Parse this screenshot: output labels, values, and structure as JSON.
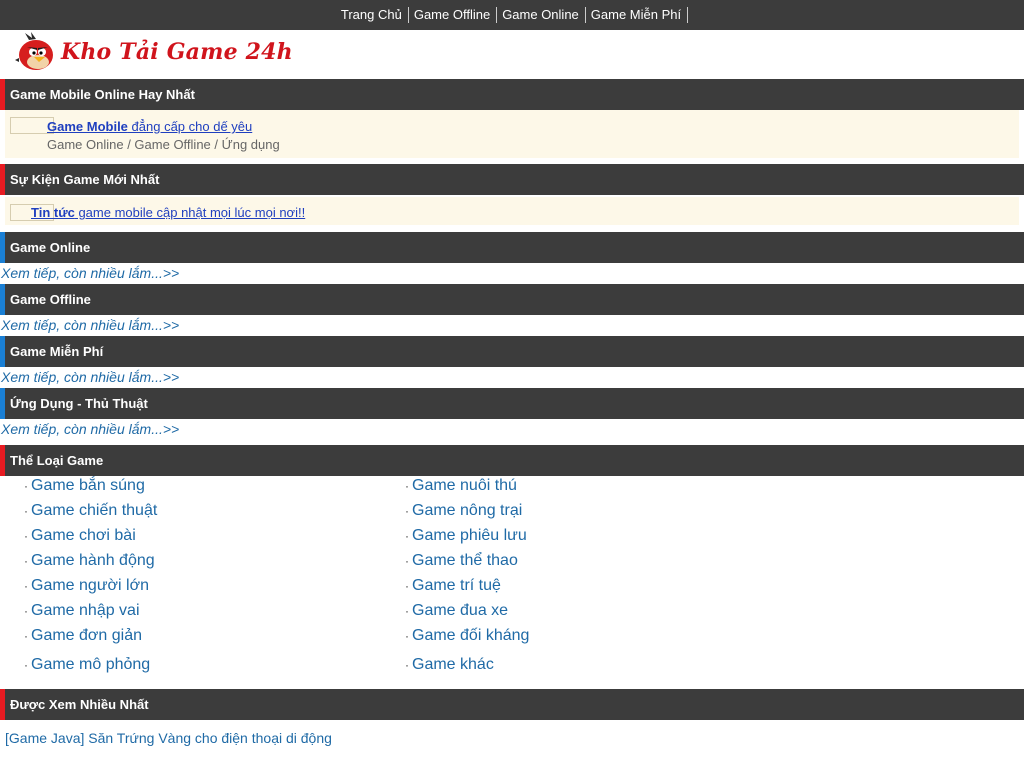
{
  "nav": {
    "items": [
      "Trang Chủ",
      "Game Offline",
      "Game Online",
      "Game Miễn Phí"
    ]
  },
  "logo": {
    "text": "Kho Tải Game 24h",
    "icon": "angry-bird-logo-icon"
  },
  "sections": {
    "mobile_online": {
      "title": "Game Mobile Online Hay Nhất",
      "featured_bold": "Game Mobile",
      "featured_text": " đẳng cấp cho dế yêu",
      "featured_breadcrumb": "Game Online / Game Offline / Ứng dụng"
    },
    "events": {
      "title": "Sự Kiện Game Mới Nhất",
      "featured_bold": "Tin tức",
      "featured_text": " game mobile cập nhật mọi lúc mọi nơi!!"
    },
    "game_online": {
      "title": "Game Online",
      "more": "Xem tiếp, còn nhiều lắm...>>"
    },
    "game_offline": {
      "title": "Game Offline",
      "more": "Xem tiếp, còn nhiều lắm...>>"
    },
    "game_free": {
      "title": "Game Miễn Phí",
      "more": "Xem tiếp, còn nhiều lắm...>>"
    },
    "apps": {
      "title": "Ứng Dụng - Thủ Thuật",
      "more": "Xem tiếp, còn nhiều lắm...>>"
    },
    "categories": {
      "title": "Thể Loại Game",
      "bullet": "·",
      "left": [
        "Game bắn súng",
        "Game chiến thuật",
        "Game chơi bài",
        "Game hành động",
        "Game người lớn",
        "Game nhập vai",
        "Game đơn giản",
        "Game mô phỏng"
      ],
      "right": [
        "Game nuôi thú",
        "Game nông trại",
        "Game phiêu lưu",
        "Game thể thao",
        "Game trí tuệ",
        "Game đua xe",
        "Game đối kháng",
        "Game khác"
      ]
    },
    "most_viewed": {
      "title": "Được Xem Nhiều Nhất",
      "items": [
        "[Game Java] Săn Trứng Vàng cho điện thoại di động"
      ]
    }
  },
  "colors": {
    "header_bg": "#3c3c3c",
    "accent_red": "#e81b22",
    "accent_blue": "#1a7fd4",
    "link": "#1f6aa6",
    "featured_bg": "#fdf8e8"
  }
}
